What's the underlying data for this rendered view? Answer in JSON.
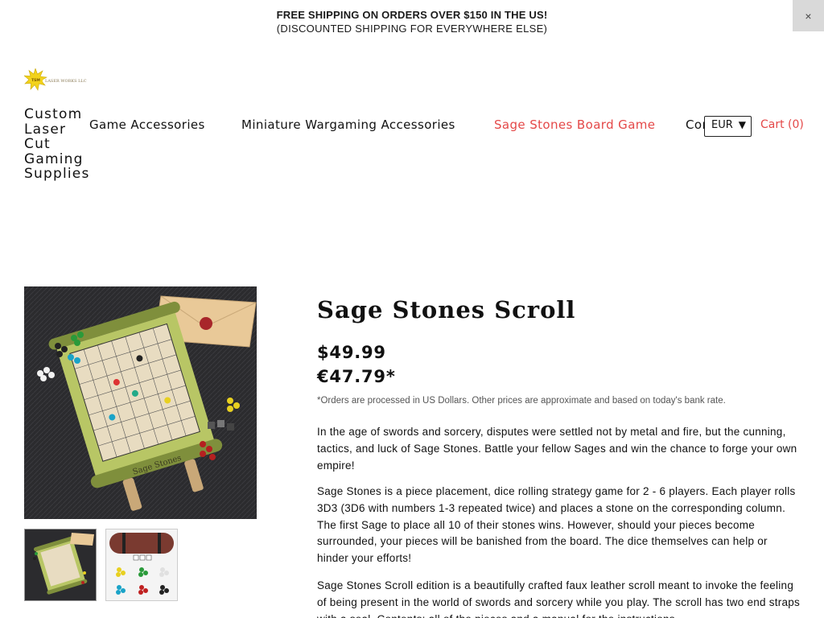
{
  "announcement": {
    "line1": "FREE SHIPPING ON ORDERS OVER $150 IN THE US!",
    "line2": "(DISCOUNTED SHIPPING FOR EVERYWHERE ELSE)",
    "close_label": "×"
  },
  "header": {
    "logo_alt": "TSM LASER WORKS LLC",
    "brand_name": "Custom Laser Cut Gaming Supplies",
    "nav": [
      {
        "label": "Game Accessories",
        "active": false
      },
      {
        "label": "Miniature Wargaming Accessories",
        "active": false
      },
      {
        "label": "Sage Stones Board Game",
        "active": true
      },
      {
        "label": "Contact",
        "active": false
      }
    ],
    "currency": {
      "selected": "EUR"
    },
    "cart_label": "Cart (0)"
  },
  "product": {
    "title": "Sage Stones Scroll",
    "price_usd": "$49.99",
    "price_eur": "€47.79*",
    "currency_note": "*Orders are processed in US Dollars. Other prices are approximate and based on today's bank rate.",
    "description": [
      "In the age of swords and sorcery, disputes were settled not by metal and fire, but the cunning, tactics, and luck of Sage Stones. Battle your fellow Sages and win the chance to forge your own empire!",
      "Sage Stones is a piece placement, dice rolling strategy game for 2 - 6 players. Each player rolls 3D3 (3D6 with numbers 1-3 repeated twice) and places a stone on the corresponding column. The first Sage to place all 10 of their stones wins. However, should your pieces become surrounded, your pieces will be banished from the board. The dice themselves can help or hinder your efforts!",
      "Sage Stones Scroll edition is a beautifully crafted faux leather scroll meant to invoke the feeling of being present in the world of swords and sorcery while you play. The scroll has two end straps with a seal. Contents: all of the pieces and a manual for the instructions."
    ]
  },
  "colors": {
    "accent": "#e44848",
    "text": "#111111",
    "close_bg": "#d9d9d9",
    "scroll_green": "#a8b85a",
    "fabric": "#2a2a2c"
  },
  "icons": {
    "close": "close-icon",
    "dropdown": "caret-down-icon"
  }
}
